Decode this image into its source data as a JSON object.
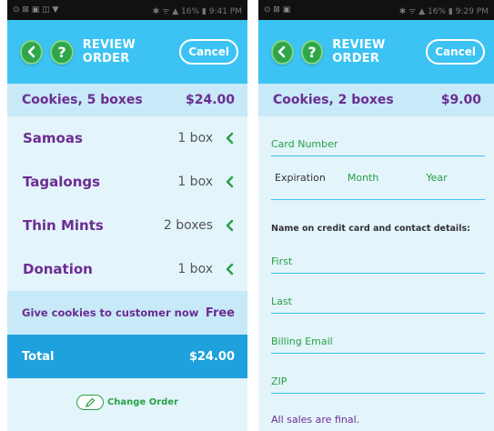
{
  "left": {
    "status": {
      "left": "⊙ ⊠ ▣ ◫ ▼",
      "right": "✱ ᯤ ▲ 16% ▮ 9:41 PM"
    },
    "header": {
      "back_icon": "chevron-left-icon",
      "help_label": "?",
      "title": "REVIEW ORDER",
      "cancel_label": "Cancel"
    },
    "summary": {
      "label": "Cookies, 5 boxes",
      "price": "$24.00"
    },
    "items": [
      {
        "name": "Samoas",
        "qty": "1 box"
      },
      {
        "name": "Tagalongs",
        "qty": "1 box"
      },
      {
        "name": "Thin Mints",
        "qty": "2 boxes"
      },
      {
        "name": "Donation",
        "qty": "1 box"
      }
    ],
    "give": {
      "label": "Give cookies to customer now",
      "value": "Free"
    },
    "total": {
      "label": "Total",
      "value": "$24.00"
    },
    "change_order_label": "Change Order"
  },
  "right": {
    "status": {
      "left": "⊙ ⊠ ▣",
      "right": "✱ ᯤ ▲ 16% ▮ 9:29 PM"
    },
    "header": {
      "back_icon": "chevron-left-icon",
      "help_label": "?",
      "title": "REVIEW ORDER",
      "cancel_label": "Cancel"
    },
    "summary": {
      "label": "Cookies, 2 boxes",
      "price": "$9.00"
    },
    "card_number_placeholder": "Card Number",
    "expiration": {
      "label": "Expiration",
      "month": "Month",
      "year": "Year"
    },
    "contact_heading": "Name on credit card and contact details:",
    "fields": {
      "first": "First",
      "last": "Last",
      "email": "Billing Email",
      "zip": "ZIP"
    },
    "final_note": "All sales are final."
  },
  "colors": {
    "header": "#3cc3f3",
    "accent_green": "#27a046",
    "purple": "#6b2d91",
    "total_bar": "#1ea1dc"
  }
}
